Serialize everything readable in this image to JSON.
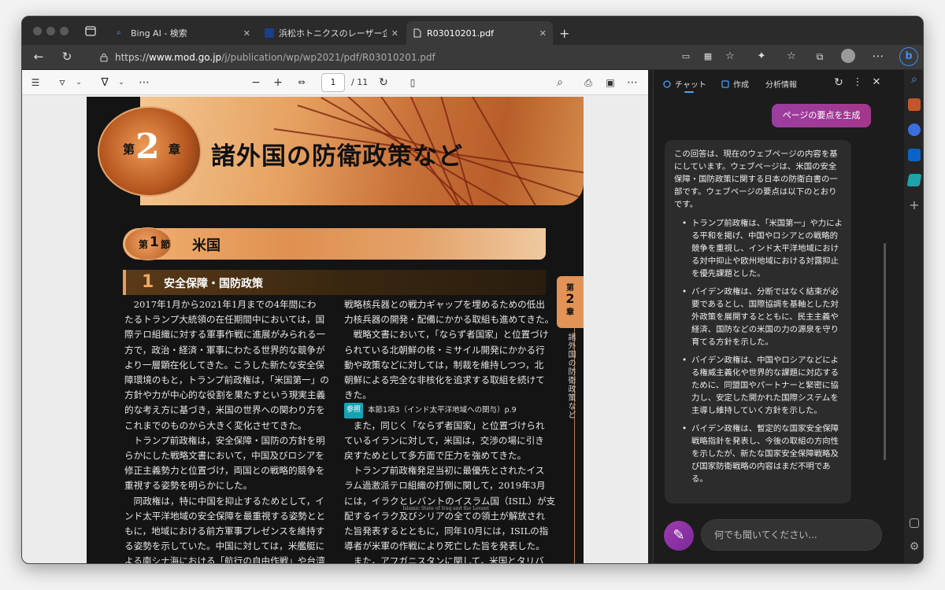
{
  "browser": {
    "tabs": [
      {
        "title": "Bing AI - 検索",
        "icon": "search-icon"
      },
      {
        "title": "浜松ホトニクスのレーザー企業買収",
        "icon": "site-favicon"
      },
      {
        "title": "R03010201.pdf",
        "icon": "document-icon"
      }
    ],
    "new_tab": "+",
    "url_prefix": "https://",
    "url_domain": "www.mod.go.jp",
    "url_path": "/j/publication/wp/wp2021/pdf/R03010201.pdf"
  },
  "pdf_toolbar": {
    "page_current": "1",
    "page_total": "/ 11"
  },
  "pdf": {
    "chapter_dai": "第",
    "chapter_num": "2",
    "chapter_sho": "章",
    "chapter_title": "諸外国の防衛政策など",
    "section_dai": "第",
    "section_num": "1",
    "section_setsu": "節",
    "section_title": "米国",
    "subsection_num": "1",
    "subsection_title": "安全保障・国防政策",
    "col1": [
      "　2017年1月から2021年1月までの4年間にわ",
      "たるトランプ大統領の在任期間中においては，国",
      "際テロ組織に対する軍事作戦に進展がみられる一",
      "方で，政治・経済・軍事にわたる世界的な競争が",
      "より一層顕在化してきた。こうした新たな安全保",
      "障環境のもと，トランプ前政権は，「米国第一」の",
      "方針や力が中心的な役割を果たすという現実主義",
      "的な考え方に基づき，米国の世界への関わり方を",
      "これまでのものから大きく変化させてきた。",
      "　トランプ前政権は，安全保障・国防の方針を明",
      "らかにした戦略文書において，中国及びロシアを",
      "修正主義勢力と位置づけ，両国との戦略的競争を",
      "重視する姿勢を明らかにした。",
      "　同政権は，特に中国を抑止するためとして，イ",
      "ンド太平洋地域の安全保障を最重視する姿勢とと",
      "もに，地域における前方軍事プレゼンスを維持す",
      "る姿勢を示していた。中国に対しては，米艦艇に",
      "よる南シナ海における「航行の自由作戦」や台湾"
    ],
    "col2a": [
      "戦略核兵器との戦力ギャップを埋めるための低出",
      "力核兵器の開発・配備にかかる取組も進めてきた。",
      "　戦略文書において，「ならず者国家」と位置づけ",
      "られている北朝鮮の核・ミサイル開発にかかる行",
      "動や政策などに対しては，制裁を維持しつつ，北",
      "朝鮮による完全な非核化を追求する取組を続けて",
      "きた。"
    ],
    "ref_badge": "参照",
    "ref_text": "本節1項3（インド太平洋地域への関与）p.9",
    "col2b": [
      "　また，同じく「ならず者国家」と位置づけられ",
      "ているイランに対して，米国は，交渉の場に引き",
      "戻すためとして多方面で圧力を強めてきた。",
      "　トランプ前政権発足当初に最優先とされたイス",
      "ラム過激派テロ組織の打倒に関して，2019年3月",
      "には，イラクとレバントのイスラム国（ISIL）が支"
    ],
    "isil_note": "Islamic State of Iraq and the Levant",
    "col2c": [
      "配するイラク及びシリアの全ての領土が解放され",
      "た旨発表するとともに，同年10月には，ISILの指",
      "導者が米軍の作戦により死亡した旨を発表した。",
      "　また，アフガニスタンに関して，米国とタリバ"
    ],
    "side_dai": "第",
    "side_num": "2",
    "side_sho": "章",
    "side_text": "諸外国の防衛政策など"
  },
  "copilot": {
    "tabs": [
      "チャット",
      "作成",
      "分析情報"
    ],
    "generate_button": "ページの要点を生成",
    "intro": "この回答は、現在のウェブページの内容を基にしています。ウェブページは、米国の安全保障・国防政策に関する日本の防衛白書の一部です。ウェブページの要点は以下のとおりです。",
    "bullets": [
      "トランプ前政権は、「米国第一」や力による平和を掲げ、中国やロシアとの戦略的競争を重視し、インド太平洋地域における対中抑止や欧州地域における対露抑止を優先課題とした。",
      "バイデン政権は、分断ではなく結束が必要であるとし、国際協調を基軸とした対外政策を展開するとともに、民主主義や経済、国防などの米国の力の源泉を守り育てる方針を示した。",
      "バイデン政権は、中国やロシアなどによる権威主義化や世界的な課題に対応するために、同盟国やパートナーと緊密に協力し、安定した開かれた国際システムを主導し維持していく方針を示した。",
      "バイデン政権は、暫定的な国家安全保障戦略指針を発表し、今後の取組の方向性を示したが、新たな国家安全保障戦略及び国家防衛戦略の内容はまだ不明である。"
    ],
    "input_placeholder": "何でも聞いてください..."
  },
  "colors": {
    "accent": "#4ea1ff",
    "copilot_button": "#9b3ea0",
    "chapter_orange": "#e39355"
  }
}
